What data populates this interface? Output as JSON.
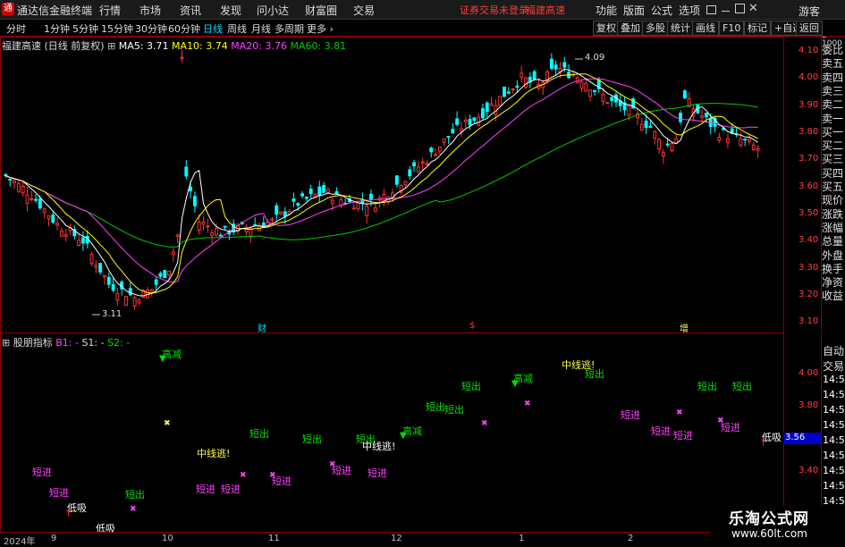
{
  "app": {
    "name": "通达信金融终端",
    "logo": "通"
  },
  "menu": [
    "行情",
    "市场",
    "资讯",
    "发现",
    "问小达",
    "财富圈",
    "交易"
  ],
  "warning": "证券交易未登录",
  "stock_short": "福建高速",
  "menu_right": [
    "功能",
    "版面",
    "公式",
    "选项"
  ],
  "win_controls": [
    "restore-icon",
    "minimize-icon",
    "maximize-icon",
    "close-icon"
  ],
  "guest": "游客",
  "periods": [
    "分时",
    "1分钟",
    "5分钟",
    "15分钟",
    "30分钟",
    "60分钟",
    "日线",
    "周线",
    "月线",
    "多周期",
    "更多 ›"
  ],
  "active_period": "日线",
  "tb_right": [
    "复权",
    "叠加",
    "多股",
    "统计",
    "画线",
    "F10",
    "标记",
    "+自选",
    "返回"
  ],
  "legend": {
    "title": "福建高速 (日线 前复权)",
    "ma5": "MA5: 3.71",
    "ma10": "MA10: 3.74",
    "ma20": "MA20: 3.76",
    "ma60": "MA60: 3.81"
  },
  "colors": {
    "up": "#ff3232",
    "down": "#00ffff",
    "ma5": "#ffffff",
    "ma10": "#ffff00",
    "ma20": "#ff40ff",
    "ma60": "#00cc00",
    "border": "#8b0000"
  },
  "price_axis": [
    "4.10",
    "4.00",
    "3.90",
    "3.80",
    "3.70",
    "3.60",
    "3.50",
    "3.40",
    "3.30",
    "3.20",
    "3.10"
  ],
  "max_label": "4.09",
  "min_label": "3.11",
  "markers": [
    "财",
    "$",
    "增"
  ],
  "indicator": {
    "name": "股朋指标",
    "b1": "B1: -",
    "s1": "S1: -",
    "s2": "S2: -"
  },
  "ind_axis": [
    "4.00",
    "3.80",
    "3.60",
    "3.40"
  ],
  "ind_current": "3.56",
  "right_panel": [
    "委比",
    "卖五",
    "卖四",
    "卖三",
    "卖二",
    "卖一",
    "买一",
    "买二",
    "买三",
    "买四",
    "买五",
    "现价",
    "涨跌",
    "涨幅",
    "总量",
    "外盘",
    "换手",
    "净资",
    "收益"
  ],
  "right_bottom": [
    "自动",
    "交易",
    "14:56",
    "14:56",
    "14:56",
    "14:56",
    "14:56",
    "14:56",
    "14:56",
    "14:56",
    "14:56",
    "14:56"
  ],
  "dates": [
    "2024年",
    "9",
    "10",
    "11",
    "12",
    "1",
    "2"
  ],
  "watermark": {
    "title": "乐淘公式网",
    "url": "www.60lt.com"
  },
  "signals": [
    {
      "t": "高减",
      "c": "g"
    },
    {
      "t": "短进",
      "c": "p"
    },
    {
      "t": "短进",
      "c": "p"
    },
    {
      "t": "低吸",
      "c": "w"
    },
    {
      "t": "低吸",
      "c": "w"
    },
    {
      "t": "短出",
      "c": "g"
    },
    {
      "t": "中线逃!",
      "c": "y"
    },
    {
      "t": "短进",
      "c": "p"
    },
    {
      "t": "短进",
      "c": "p"
    },
    {
      "t": "短出",
      "c": "g"
    },
    {
      "t": "短进",
      "c": "p"
    },
    {
      "t": "短出",
      "c": "g"
    },
    {
      "t": "短进",
      "c": "p"
    },
    {
      "t": "短进",
      "c": "p"
    },
    {
      "t": "短出",
      "c": "g"
    },
    {
      "t": "中线逃!",
      "c": "w"
    },
    {
      "t": "高减",
      "c": "g"
    },
    {
      "t": "短出",
      "c": "g"
    },
    {
      "t": "短出",
      "c": "g"
    },
    {
      "t": "短出",
      "c": "g"
    },
    {
      "t": "高减",
      "c": "g"
    },
    {
      "t": "中线逃!",
      "c": "y"
    },
    {
      "t": "短出",
      "c": "g"
    },
    {
      "t": "短进",
      "c": "p"
    },
    {
      "t": "短进",
      "c": "p"
    },
    {
      "t": "短进",
      "c": "p"
    },
    {
      "t": "短出",
      "c": "g"
    },
    {
      "t": "短出",
      "c": "g"
    },
    {
      "t": "短进",
      "c": "p"
    },
    {
      "t": "低吸",
      "c": "w"
    }
  ]
}
